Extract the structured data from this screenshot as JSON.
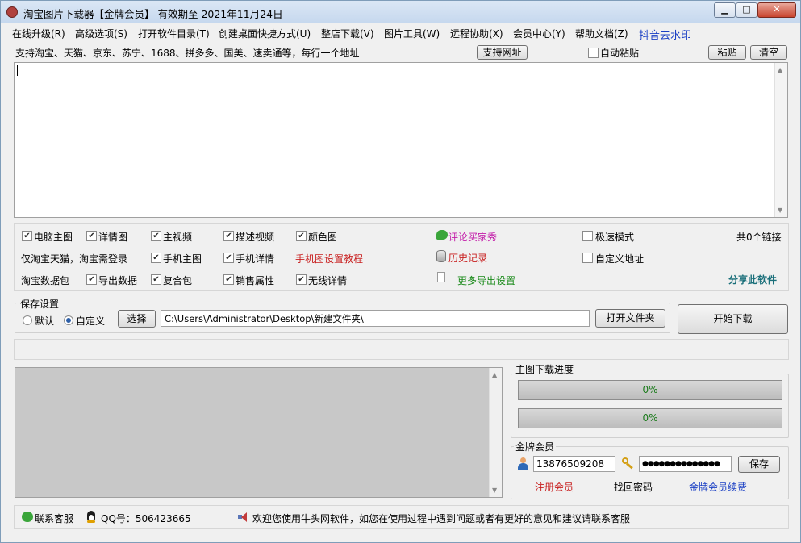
{
  "window": {
    "title": "淘宝图片下载器【金牌会员】 有效期至 2021年11月24日",
    "controls": {
      "minimize": "▁",
      "maximize": "□",
      "close": "✕"
    }
  },
  "menu": [
    "在线升级(R)",
    "高级选项(S)",
    "打开软件目录(T)",
    "创建桌面快捷方式(U)",
    "整店下载(V)",
    "图片工具(W)",
    "远程协助(X)",
    "会员中心(Y)",
    "帮助文档(Z)",
    "抖音去水印"
  ],
  "input_area": {
    "hint": "支持淘宝、天猫、京东、苏宁、1688、拼多多、国美、速卖通等，每行一个地址",
    "support_button": "支持网址",
    "auto_paste_label": "自动粘贴",
    "auto_paste_checked": false,
    "paste_button": "粘贴",
    "clear_button": "清空",
    "text": ""
  },
  "options": {
    "row1": [
      {
        "label": "电脑主图",
        "checked": true
      },
      {
        "label": "详情图",
        "checked": true
      },
      {
        "label": "主视频",
        "checked": true
      },
      {
        "label": "描述视频",
        "checked": true
      },
      {
        "label": "颜色图",
        "checked": true
      }
    ],
    "row2_note": "仅淘宝天猫，淘宝需登录",
    "row2": [
      {
        "label": "手机主图",
        "checked": true
      },
      {
        "label": "手机详情",
        "checked": true
      }
    ],
    "mobile_tutorial_link": "手机图设置教程",
    "row3_note": "淘宝数据包",
    "row3": [
      {
        "label": "导出数据",
        "checked": true
      },
      {
        "label": "复合包",
        "checked": true
      },
      {
        "label": "销售属性",
        "checked": true
      },
      {
        "label": "无线详情",
        "checked": true
      }
    ],
    "comment_link": "评论买家秀",
    "history_link": "历史记录",
    "more_export_link": "更多导出设置",
    "fast_mode": {
      "label": "极速模式",
      "checked": false
    },
    "custom_address": {
      "label": "自定义地址",
      "checked": false
    },
    "link_count": "共0个链接",
    "share_link": "分享此软件"
  },
  "save_settings": {
    "title": "保存设置",
    "default_label": "默认",
    "custom_label": "自定义",
    "selected": "custom",
    "choose_button": "选择",
    "path": "C:\\Users\\Administrator\\Desktop\\新建文件夹\\",
    "open_folder_button": "打开文件夹",
    "start_button": "开始下载"
  },
  "progress": {
    "title": "主图下载进度",
    "bar1_text": "0%",
    "bar1_value": 0,
    "bar2_text": "0%",
    "bar2_value": 0
  },
  "member": {
    "title": "金牌会员",
    "account": "13876509208",
    "password": "●●●●●●●●●●●●●●",
    "save_button": "保存",
    "register_link": "注册会员",
    "recover_link": "找回密码",
    "renew_link": "金牌会员续费"
  },
  "status_bar": {
    "contact": "联系客服",
    "qq": "QQ号：506423665",
    "welcome": "欢迎您使用牛头网软件，如您在使用过程中遇到问题或者有更好的意见和建议请联系客服"
  },
  "colors": {
    "link_blue": "#1a3fc4",
    "link_magenta": "#c21aa8",
    "link_red": "#c81e1e",
    "link_green": "#1a8a1a",
    "link_teal": "#1a6f7a"
  },
  "icons": {
    "comment": "speech-bubble-icon",
    "history": "database-icon",
    "more_export": "document-icon",
    "user": "user-icon",
    "key": "key-icon",
    "contact": "wechat-icon",
    "qq": "penguin-icon",
    "speaker": "speaker-icon"
  }
}
